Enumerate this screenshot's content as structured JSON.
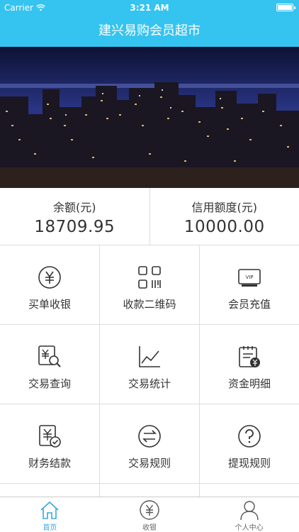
{
  "status_bar": {
    "carrier": "Carrier",
    "time": "3:21 AM"
  },
  "nav": {
    "title": "建兴易购会员超市"
  },
  "balance": {
    "balance_label": "余额(元)",
    "balance_value": "18709.95",
    "credit_label": "信用额度(元)",
    "credit_value": "10000.00"
  },
  "grid": {
    "items": [
      {
        "label": "买单收银",
        "icon": "yuan-circle-icon"
      },
      {
        "label": "收款二维码",
        "icon": "qr-code-icon"
      },
      {
        "label": "会员充值",
        "icon": "vip-card-icon"
      },
      {
        "label": "交易查询",
        "icon": "search-yuan-icon"
      },
      {
        "label": "交易统计",
        "icon": "line-chart-icon"
      },
      {
        "label": "资金明细",
        "icon": "ledger-yuan-icon"
      },
      {
        "label": "财务结款",
        "icon": "settlement-check-icon"
      },
      {
        "label": "交易规则",
        "icon": "exchange-arrows-icon"
      },
      {
        "label": "提现规则",
        "icon": "question-circle-icon"
      }
    ]
  },
  "tabs": [
    {
      "label": "首页",
      "icon": "home-icon"
    },
    {
      "label": "收银",
      "icon": "yuan-circle-icon"
    },
    {
      "label": "个人中心",
      "icon": "person-icon"
    }
  ],
  "colors": {
    "accent": "#35c3f0",
    "tab_active": "#35a8e0",
    "text": "#333333",
    "divider": "#dddddd"
  }
}
